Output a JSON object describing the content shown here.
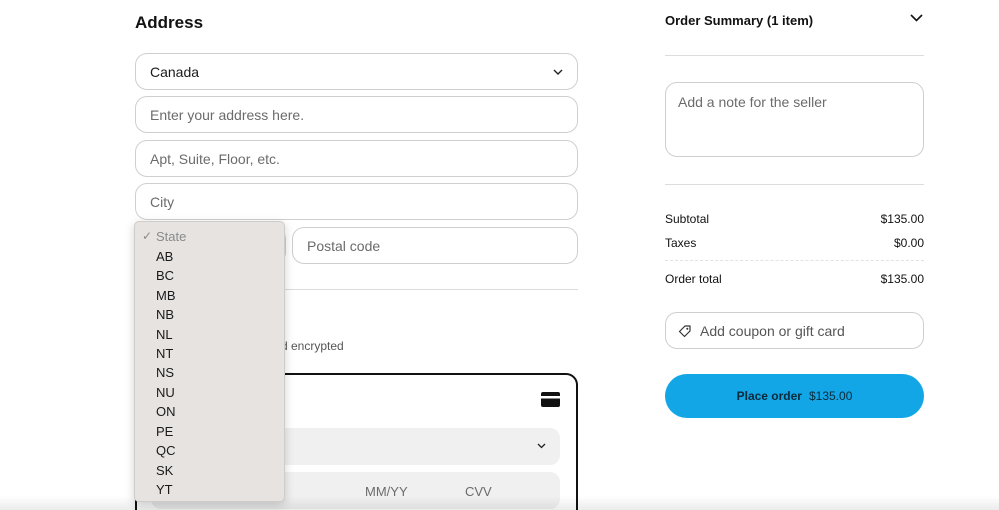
{
  "address": {
    "title": "Address",
    "country": "Canada",
    "address_placeholder": "Enter your address here.",
    "apt_placeholder": "Apt, Suite, Floor, etc.",
    "city_placeholder": "City",
    "postal_placeholder": "Postal code"
  },
  "state_dropdown": {
    "selected_marker": "✓",
    "options": [
      "State",
      "AB",
      "BC",
      "MB",
      "NB",
      "NL",
      "NT",
      "NS",
      "NU",
      "ON",
      "PE",
      "QC",
      "SK",
      "YT"
    ]
  },
  "payment": {
    "encrypted_text": "d encrypted",
    "expiry_placeholder": "MM/YY",
    "cvv_placeholder": "CVV"
  },
  "summary": {
    "title": "Order Summary (1 item)",
    "note_placeholder": "Add a note for the seller",
    "subtotal_label": "Subtotal",
    "subtotal_value": "$135.00",
    "taxes_label": "Taxes",
    "taxes_value": "$0.00",
    "total_label": "Order total",
    "total_value": "$135.00",
    "coupon_label": "Add coupon or gift card",
    "place_order_label": "Place order",
    "place_order_amount": "$135.00"
  },
  "colors": {
    "accent": "#12a6e6",
    "dropdown_bg": "#e6e3e1"
  },
  "icons": {
    "country_chevron": "chevron-down-icon",
    "summary_chevron": "chevron-down-icon",
    "card": "credit-card-icon",
    "coupon": "tag-icon"
  }
}
